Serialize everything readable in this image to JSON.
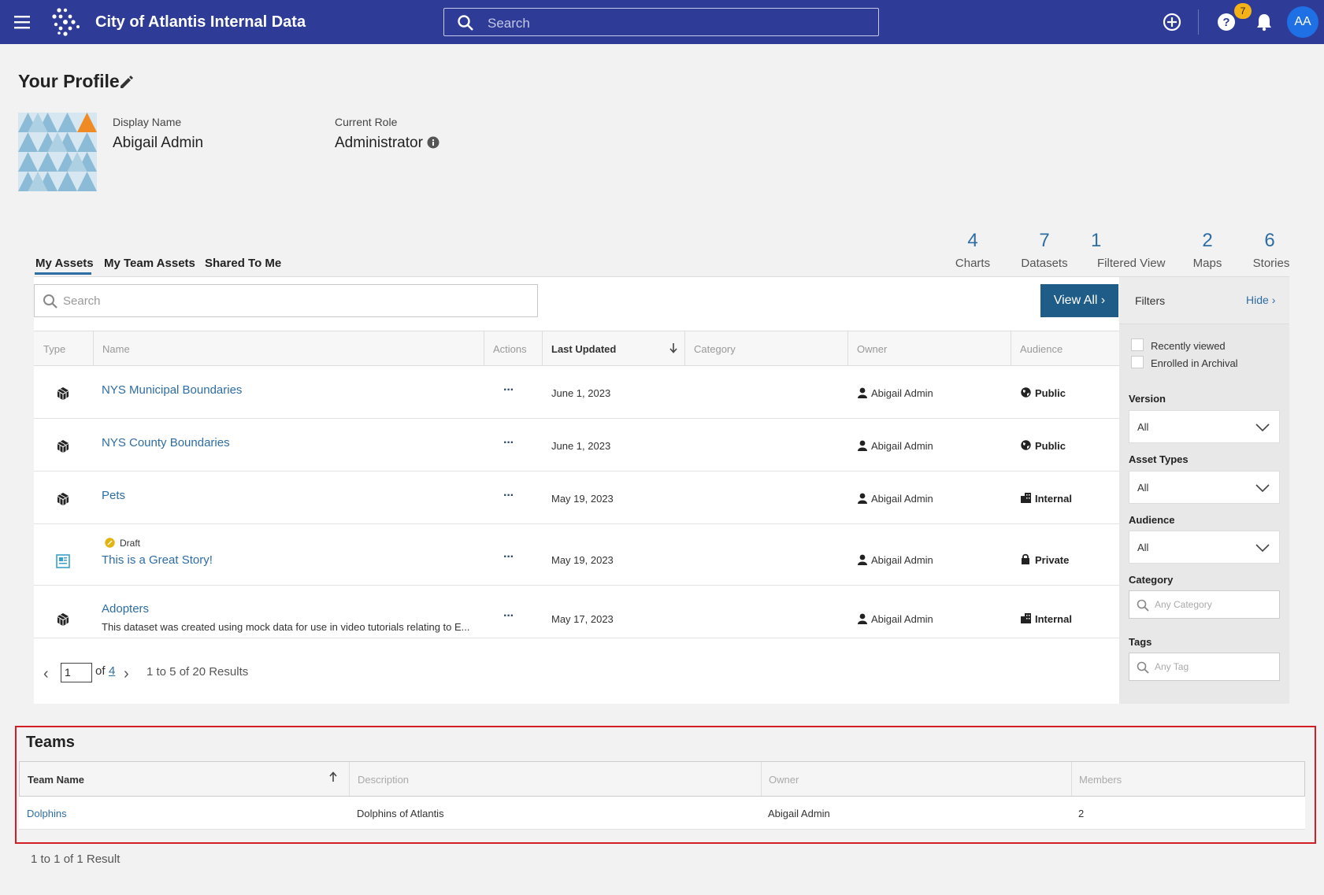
{
  "app": {
    "title": "City of Atlantis Internal Data"
  },
  "topbar": {
    "search_placeholder": "Search",
    "notification_count": "7",
    "avatar_initials": "AA"
  },
  "profile": {
    "title": "Your Profile",
    "display_name_label": "Display Name",
    "display_name": "Abigail Admin",
    "role_label": "Current Role",
    "role": "Administrator"
  },
  "tabs": [
    {
      "label": "My Assets",
      "active": true
    },
    {
      "label": "My Team Assets",
      "active": false
    },
    {
      "label": "Shared To Me",
      "active": false
    }
  ],
  "stats": [
    {
      "count": "4",
      "label": "Charts"
    },
    {
      "count": "7",
      "label": "Datasets"
    },
    {
      "count": "1",
      "label": "Filtered View"
    },
    {
      "count": "2",
      "label": "Maps"
    },
    {
      "count": "6",
      "label": "Stories"
    }
  ],
  "assets": {
    "search_placeholder": "Search",
    "view_all_label": "View All",
    "columns": [
      "Type",
      "Name",
      "Actions",
      "Last Updated",
      "Category",
      "Owner",
      "Audience"
    ],
    "rows": [
      {
        "type_icon": "dataset-icon",
        "name": "NYS Municipal Boundaries",
        "badge": "",
        "description": "",
        "last_updated": "June 1, 2023",
        "owner": "Abigail Admin",
        "audience": "Public",
        "audience_icon": "globe-icon"
      },
      {
        "type_icon": "dataset-icon",
        "name": "NYS County Boundaries",
        "badge": "",
        "description": "",
        "last_updated": "June 1, 2023",
        "owner": "Abigail Admin",
        "audience": "Public",
        "audience_icon": "globe-icon"
      },
      {
        "type_icon": "dataset-icon",
        "name": "Pets",
        "badge": "",
        "description": "",
        "last_updated": "May 19, 2023",
        "owner": "Abigail Admin",
        "audience": "Internal",
        "audience_icon": "building-icon"
      },
      {
        "type_icon": "story-icon",
        "name": "This is a Great Story!",
        "badge": "Draft",
        "description": "",
        "last_updated": "May 19, 2023",
        "owner": "Abigail Admin",
        "audience": "Private",
        "audience_icon": "lock-icon"
      },
      {
        "type_icon": "dataset-icon",
        "name": "Adopters",
        "badge": "",
        "description": "This dataset was created using mock data for use in video tutorials relating to E...",
        "last_updated": "May 17, 2023",
        "owner": "Abigail Admin",
        "audience": "Internal",
        "audience_icon": "building-icon"
      }
    ],
    "pagination": {
      "current_page": "1",
      "of_label": "of",
      "total_pages": "4",
      "summary": "1 to 5 of 20 Results"
    }
  },
  "filters": {
    "title": "Filters",
    "hide_label": "Hide",
    "checkboxes": [
      "Recently viewed",
      "Enrolled in Archival"
    ],
    "version_label": "Version",
    "version_value": "All",
    "asset_types_label": "Asset Types",
    "asset_types_value": "All",
    "audience_label": "Audience",
    "audience_value": "All",
    "category_label": "Category",
    "category_placeholder": "Any Category",
    "tags_label": "Tags",
    "tags_placeholder": "Any Tag"
  },
  "teams": {
    "title": "Teams",
    "columns": [
      "Team Name",
      "Description",
      "Owner",
      "Members"
    ],
    "rows": [
      {
        "name": "Dolphins",
        "description": "Dolphins of Atlantis",
        "owner": "Abigail Admin",
        "members": "2"
      }
    ],
    "summary": "1 to 1 of 1 Result"
  }
}
